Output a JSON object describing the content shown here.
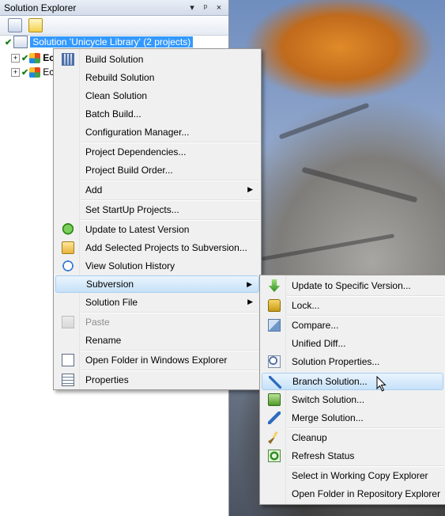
{
  "explorer": {
    "title": "Solution Explorer",
    "title_buttons": [
      "▾",
      "ᵖ",
      "×"
    ],
    "solution_label": "Solution 'Unicycle Library' (2 projects)",
    "projects": [
      "Ec",
      "Ec"
    ]
  },
  "solution_menu": {
    "items": [
      {
        "label": "Build Solution",
        "icon": "build-icon"
      },
      {
        "label": "Rebuild Solution",
        "icon": ""
      },
      {
        "label": "Clean Solution",
        "icon": ""
      },
      {
        "label": "Batch Build...",
        "icon": ""
      },
      {
        "label": "Configuration Manager...",
        "icon": ""
      },
      {
        "label": "Project Dependencies...",
        "icon": ""
      },
      {
        "label": "Project Build Order...",
        "icon": ""
      },
      {
        "label": "Add",
        "icon": "",
        "submenu": true
      },
      {
        "label": "Set StartUp Projects...",
        "icon": ""
      },
      {
        "label": "Update to Latest Version",
        "icon": "update-icon"
      },
      {
        "label": "Add Selected Projects to Subversion...",
        "icon": "add-folder-icon"
      },
      {
        "label": "View Solution History",
        "icon": "history-icon"
      },
      {
        "label": "Subversion",
        "icon": "",
        "submenu": true,
        "highlighted": true
      },
      {
        "label": "Solution File",
        "icon": "",
        "submenu": true
      },
      {
        "label": "Paste",
        "icon": "paste-icon",
        "disabled": true
      },
      {
        "label": "Rename",
        "icon": ""
      },
      {
        "label": "Open Folder in Windows Explorer",
        "icon": "open-folder-icon"
      },
      {
        "label": "Properties",
        "icon": "properties-icon"
      }
    ]
  },
  "subversion_menu": {
    "items": [
      {
        "label": "Update to Specific Version...",
        "icon": "update-down-icon"
      },
      {
        "label": "Lock...",
        "icon": "lock-icon"
      },
      {
        "label": "Compare...",
        "icon": "compare-icon"
      },
      {
        "label": "Unified Diff...",
        "icon": ""
      },
      {
        "label": "Solution Properties...",
        "icon": "solution-properties-icon"
      },
      {
        "label": "Branch Solution...",
        "icon": "branch-icon",
        "highlighted": true
      },
      {
        "label": "Switch Solution...",
        "icon": "switch-icon"
      },
      {
        "label": "Merge Solution...",
        "icon": "merge-icon"
      },
      {
        "label": "Cleanup",
        "icon": "broom-icon"
      },
      {
        "label": "Refresh Status",
        "icon": "refresh-icon"
      },
      {
        "label": "Select in Working Copy Explorer",
        "icon": ""
      },
      {
        "label": "Open Folder in Repository Explorer",
        "icon": ""
      }
    ]
  }
}
